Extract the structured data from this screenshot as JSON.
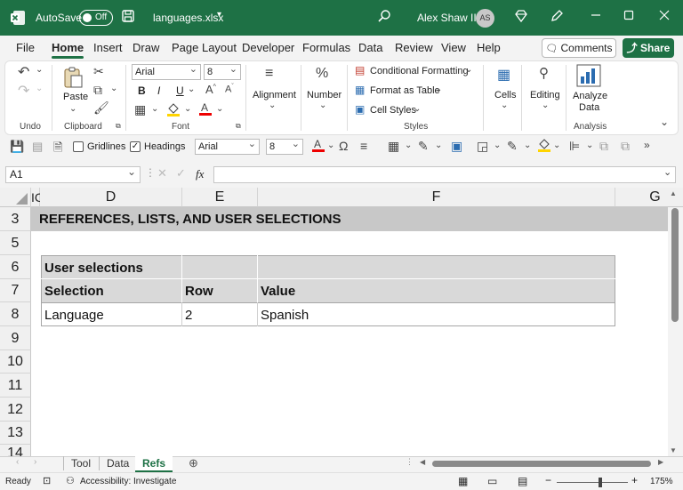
{
  "titlebar": {
    "autosave_label": "AutoSave",
    "autosave_state": "Off",
    "filename": "languages.xlsx",
    "user_name": "Alex Shaw III",
    "user_initials": "AS"
  },
  "tabs": [
    "File",
    "Home",
    "Insert",
    "Draw",
    "Page Layout",
    "Developer",
    "Formulas",
    "Data",
    "Review",
    "View",
    "Help"
  ],
  "active_tab": "Home",
  "comments_label": "Comments",
  "share_label": "Share",
  "ribbon": {
    "undo_group": "Undo",
    "paste_label": "Paste",
    "clipboard_group": "Clipboard",
    "font_name": "Arial",
    "font_size": "8",
    "font_group": "Font",
    "alignment_label": "Alignment",
    "number_label": "Number",
    "conditional_formatting": "Conditional Formatting",
    "format_as_table": "Format as Table",
    "cell_styles": "Cell Styles",
    "styles_group": "Styles",
    "cells_label": "Cells",
    "editing_label": "Editing",
    "analyze_label_1": "Analyze",
    "analyze_label_2": "Data",
    "analysis_group": "Analysis",
    "bold": "B",
    "italic": "I",
    "underline": "U"
  },
  "qat": {
    "gridlines_label": "Gridlines",
    "headings_label": "Headings",
    "font_name": "Arial",
    "font_size": "8"
  },
  "formula_bar": {
    "name_box": "A1",
    "fx": "fx",
    "value": ""
  },
  "grid": {
    "columns": [
      "IC",
      "D",
      "E",
      "F",
      "G"
    ],
    "rows": [
      "3",
      "5",
      "6",
      "7",
      "8",
      "9",
      "10",
      "11",
      "12",
      "13",
      "14"
    ],
    "section_title": "REFERENCES, LISTS, AND USER SELECTIONS",
    "table_title": "User selections",
    "headers": [
      "Selection",
      "Row",
      "Value"
    ],
    "data_row": [
      "Language",
      "2",
      "Spanish"
    ]
  },
  "sheets": [
    "Tool",
    "Data",
    "Refs"
  ],
  "active_sheet": "Refs",
  "status": {
    "ready": "Ready",
    "accessibility": "Accessibility: Investigate",
    "zoom": "175%"
  },
  "colors": {
    "brand": "#1e7145",
    "header_fill": "#c8c8c8",
    "table_fill": "#d9d9d9"
  }
}
